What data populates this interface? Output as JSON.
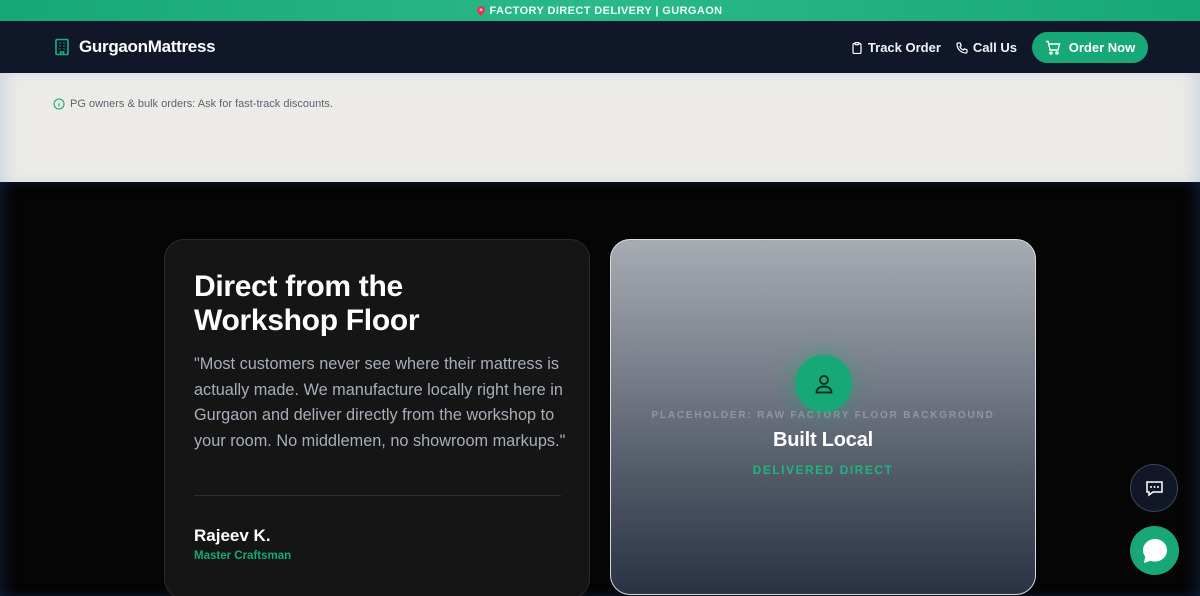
{
  "announcement": {
    "text": "FACTORY DIRECT DELIVERY | GURGAON",
    "icon": "map-pin-icon"
  },
  "nav": {
    "brand": "GurgaonMattress",
    "brand_icon": "building-icon",
    "links": [
      {
        "label": "Track Order",
        "icon": "clipboard-icon"
      },
      {
        "label": "Call Us",
        "icon": "phone-icon"
      }
    ],
    "cta": {
      "label": "Order Now",
      "icon": "cart-icon"
    }
  },
  "notice": {
    "text": "PG owners & bulk orders: Ask for fast-track discounts.",
    "icon": "info-icon"
  },
  "testimonial": {
    "title": "Direct from the Workshop Floor",
    "quote": "\"Most customers never see where their mattress is actually made. We manufacture locally right here in Gurgaon and deliver directly from the workshop to your room. No middlemen, no showroom markups.\"",
    "author_name": "Rajeev K.",
    "author_role": "Master Craftsman"
  },
  "feature_card": {
    "placeholder": "PLACEHOLDER: RAW FACTORY FLOOR BACKGROUND",
    "icon": "user-icon",
    "title": "Built Local",
    "subtitle": "DELIVERED DIRECT"
  },
  "floating": {
    "chat_icon": "chat-bubble-icon",
    "whatsapp_icon": "whatsapp-icon"
  },
  "colors": {
    "accent": "#16a877",
    "navy": "#0f1729",
    "cream": "#ecebe7",
    "dark": "#050505"
  }
}
